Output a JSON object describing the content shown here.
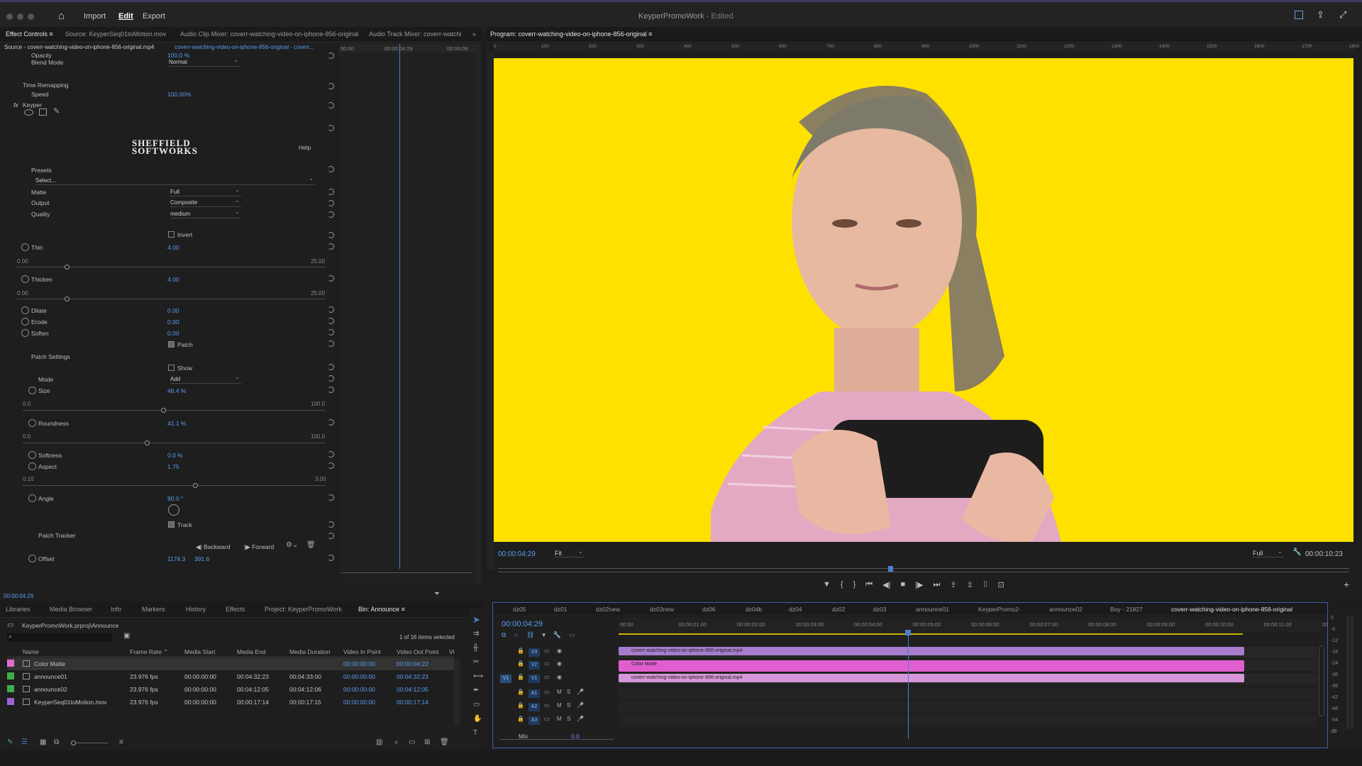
{
  "app": {
    "title": "KeyperPromoWork",
    "status": "- Edited",
    "menu": [
      "Import",
      "Edit",
      "Export"
    ]
  },
  "panel_tabs": [
    "Effect Controls",
    "Source: KeyperSeq01toMotion.mov",
    "Audio Clip Mixer: coverr-watching-video-on-iphone-856-original",
    "Audio Track Mixer: coverr-watching"
  ],
  "ec": {
    "source": "Source - coverr-watching-video-on-iphone-856-original.mp4",
    "seq": "coverr-watching-video-on-iphone-856-original - coverr...",
    "tl_times": [
      "00:00",
      "00:00:04:29",
      "00:00:09"
    ],
    "opacity_lbl": "Opacity",
    "opacity_val": "100.0 %",
    "blend_lbl": "Blend Mode",
    "blend_val": "Normal",
    "timeremap_lbl": "Time Remapping",
    "speed_lbl": "Speed",
    "speed_val": "100.00%",
    "fx_lbl": "fx",
    "keyper_lbl": "Keyper",
    "logo1": "SHEFFIELD",
    "logo2": "SOFTWORKS",
    "help": "Help",
    "presets_lbl": "Presets",
    "presets_val": "Select...",
    "matte_lbl": "Matte",
    "matte_val": "Full",
    "output_lbl": "Output",
    "output_val": "Composite",
    "quality_lbl": "Quality",
    "quality_val": "medium",
    "invert": "Invert",
    "thin_lbl": "Thin",
    "thin_val": "4.00",
    "thin_min": "0.00",
    "thin_max": "25.00",
    "thin_pct": 0.16,
    "thicken_lbl": "Thicken",
    "thicken_val": "4.00",
    "thicken_min": "0.00",
    "thicken_max": "25.00",
    "thicken_pct": 0.16,
    "dilate_lbl": "Dilate",
    "dilate_val": "0.00",
    "erode_lbl": "Erode",
    "erode_val": "0.00",
    "soften_lbl": "Soften",
    "soften_val": "0.00",
    "patch": "Patch",
    "patchset_lbl": "Patch Settings",
    "show": "Show",
    "mode_lbl": "Mode",
    "mode_val": "Add",
    "size_lbl": "Size",
    "size_val": "46.4 %",
    "size_min": "0.0",
    "size_max": "100.0",
    "size_pct": 0.464,
    "round_lbl": "Roundness",
    "round_val": "41.1 %",
    "round_min": "0.0",
    "round_max": "100.0",
    "round_pct": 0.411,
    "softness_lbl": "Softness",
    "softness_val": "0.0 %",
    "aspect_lbl": "Aspect",
    "aspect_val": "1.75",
    "aspect_min": "0.10",
    "aspect_max": "3.00",
    "aspect_pct": 0.57,
    "angle_lbl": "Angle",
    "angle_val": "90.0 °",
    "track": "Track",
    "tracker_lbl": "Patch Tracker",
    "backward": "Backward",
    "forward": "Forward",
    "offset_lbl": "Offset",
    "offset_x": "1174.3",
    "offset_y": "391.6",
    "time": "00:00:04:29"
  },
  "program": {
    "tab": "Program: coverr-watching-video-on-iphone-856-original",
    "tc": "00:00:04:29",
    "fit": "Fit",
    "full": "Full",
    "duration": "00:00:10:23",
    "ruler": [
      "0",
      "100",
      "200",
      "300",
      "400",
      "500",
      "600",
      "700",
      "800",
      "900",
      "1000",
      "1100",
      "1200",
      "1300",
      "1400",
      "1500",
      "1600",
      "1700",
      "1800"
    ],
    "bg": "#ffe100"
  },
  "project": {
    "tabs": [
      "Libraries",
      "Media Browser",
      "Info",
      "Markers",
      "History",
      "Effects",
      "Project: KeyperPromoWork",
      "Bin: Announce"
    ],
    "path": "KeyperPromoWork.prproj\\Announce",
    "selected": "1 of 16 items selected",
    "cols": [
      "Name",
      "Frame Rate",
      "Media Start",
      "Media End",
      "Media Duration",
      "Video In Point",
      "Video Out Point",
      "Vi"
    ],
    "rows": [
      {
        "name": "Color Matte",
        "fr": "",
        "ms": "",
        "me": "",
        "md": "",
        "vin": "00:00:00:00",
        "vout": "00:00:04:22",
        "color": "#e26bd0"
      },
      {
        "name": "announce01",
        "fr": "23.976 fps",
        "ms": "00:00:00:00",
        "me": "00:04:32:23",
        "md": "00:04:33:00",
        "vin": "00:00:00:00",
        "vout": "00:04:32:23",
        "color": "#3fae48"
      },
      {
        "name": "announce02",
        "fr": "23.976 fps",
        "ms": "00:00:00:00",
        "me": "00:04:12:05",
        "md": "00:04:12:06",
        "vin": "00:00:00:00",
        "vout": "00:04:12:05",
        "color": "#3fae48"
      },
      {
        "name": "KeyperSeq01toMotion.mov",
        "fr": "23.976 fps",
        "ms": "00:00:00:00",
        "me": "00:00:17:14",
        "md": "00:00:17:15",
        "vin": "00:00:00:00",
        "vout": "00:00:17:14",
        "color": "#9b63d8"
      }
    ]
  },
  "timeline": {
    "tabs": [
      "dz05",
      "dz01",
      "dz02new",
      "dz03new",
      "dz06",
      "dz04b",
      "dz04",
      "dz02",
      "dz03",
      "announce01",
      "KeyperPromo2-",
      "announce02",
      "Boy - 21827",
      "coverr-watching-video-on-iphone-856-original"
    ],
    "tc": "00:00:04:29",
    "ruler": [
      "00:00",
      "00:00:01:00",
      "00:00:02:00",
      "00:00:03:00",
      "00:00:04:00",
      "00:00:05:00",
      "00:00:06:00",
      "00:00:07:00",
      "00:00:08:00",
      "00:00:09:00",
      "00:00:10:00",
      "00:00:11:00",
      "00:0"
    ],
    "tracks": [
      "V3",
      "V2",
      "V1",
      "A1",
      "A2",
      "A3"
    ],
    "target": "V1",
    "clip_v3": "coverr-watching-video-on-iphone-856-original.mp4",
    "clip_v2": "Color Matte",
    "clip_v1": "coverr-watching-video-on-iphone-856-original.mp4",
    "mix": "Mix",
    "mixval": "0.0",
    "meter": [
      "0",
      "-6",
      "-12",
      "-18",
      "-24",
      "-30",
      "-36",
      "-42",
      "-48",
      "-54",
      "dB"
    ]
  }
}
